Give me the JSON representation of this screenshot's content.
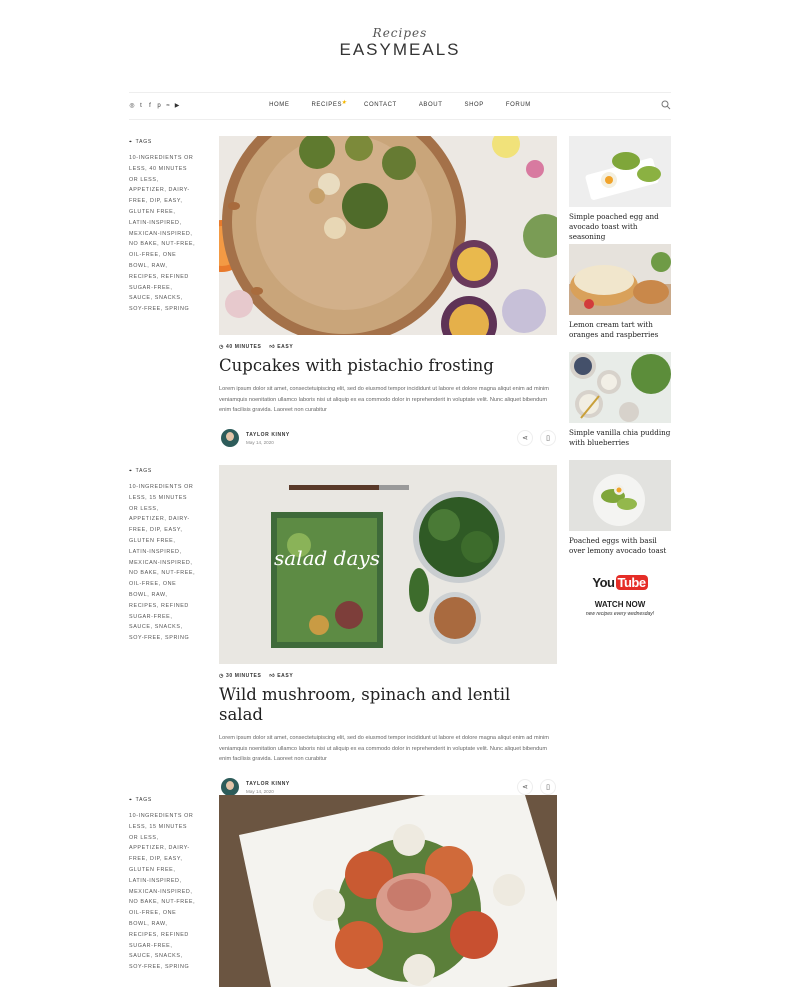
{
  "site": {
    "logo_script": "Recipes",
    "logo_main": "EASYMEALS"
  },
  "nav": {
    "social_icons": [
      "instagram-icon",
      "twitter-icon",
      "facebook-icon",
      "pinterest-icon",
      "rss-icon",
      "youtube-icon"
    ],
    "items": [
      {
        "label": "HOME"
      },
      {
        "label": "RECIPES"
      },
      {
        "label": "CONTACT"
      },
      {
        "label": "ABOUT"
      },
      {
        "label": "SHOP"
      },
      {
        "label": "FORUM"
      }
    ]
  },
  "posts": [
    {
      "tags_title": "TAGS",
      "tags_text": "10-INGREDIENTS OR LESS, 40 MINUTES OR LESS, APPETIZER, DAIRY-FREE, DIP, EASY, GLUTEN FREE, LATIN-INSPIRED, MEXICAN-INSPIRED, NO BAKE, NUT-FREE, OIL-FREE, ONE BOWL, RAW, RECIPES, REFINED SUGAR-FREE, SAUCE, SNACKS, SOY-FREE, SPRING",
      "time": "40 MINUTES",
      "difficulty": "EASY",
      "title": "Cupcakes with pistachio frosting",
      "excerpt": "Lorem ipsum dolor sit amet, consectetuipiscing elit, sed do eiusmod tempor incididunt ut labore et dolore magna aliqut enim ad minim veniamquis noenitation ullamco laboris nisi ut aliquip ex ea commodo dolor in reprehenderit in voluptate velit. Nunc aliquet bibendum enim facilisis gravida. Laoreet non curabitur",
      "author": "TAYLOR KINNY",
      "date": "May 14, 2020"
    },
    {
      "tags_title": "TAGS",
      "tags_text": "10-INGREDIENTS OR LESS, 15 MINUTES OR LESS, APPETIZER, DAIRY-FREE, DIP, EASY, GLUTEN FREE, LATIN-INSPIRED, MEXICAN-INSPIRED, NO BAKE, NUT-FREE, OIL-FREE, ONE BOWL, RAW, RECIPES, REFINED SUGAR-FREE, SAUCE, SNACKS, SOY-FREE, SPRING",
      "time": "30 MINUTES",
      "difficulty": "EASY",
      "title": "Wild mushroom, spinach and lentil salad",
      "excerpt": "Lorem ipsum dolor sit amet, consectetuipiscing elit, sed do eiusmod tempor incididunt ut labore et dolore magna aliqut enim ad minim veniamquis noenitation ullamco laboris nisi ut aliquip ex ea commodo dolor in reprehenderit in voluptate velit. Nunc aliquet bibendum enim facilisis gravida. Laoreet non curabitur",
      "author": "TAYLOR KINNY",
      "date": "May 14, 2020",
      "book_title": "salad days"
    },
    {
      "tags_title": "TAGS",
      "tags_text": "10-INGREDIENTS OR LESS, 15 MINUTES OR LESS, APPETIZER, DAIRY-FREE, DIP, EASY, GLUTEN FREE, LATIN-INSPIRED, MEXICAN-INSPIRED, NO BAKE, NUT-FREE, OIL-FREE, ONE BOWL, RAW, RECIPES, REFINED SUGAR-FREE, SAUCE, SNACKS, SOY-FREE, SPRING"
    }
  ],
  "sidebar": {
    "items": [
      {
        "caption": "Simple poached egg and avocado toast with seasoning"
      },
      {
        "caption": "Lemon cream tart with oranges and raspberries"
      },
      {
        "caption": "Simple vanilla chia pudding with blueberries"
      },
      {
        "caption": "Poached eggs with basil over lemony avocado toast"
      }
    ],
    "youtube": {
      "you": "You",
      "tube": "Tube",
      "watch": "WATCH NOW",
      "sub": "new recipes every wednesday!"
    }
  },
  "colors": {
    "accent_star": "#f5b700",
    "youtube_red": "#e52d27"
  }
}
